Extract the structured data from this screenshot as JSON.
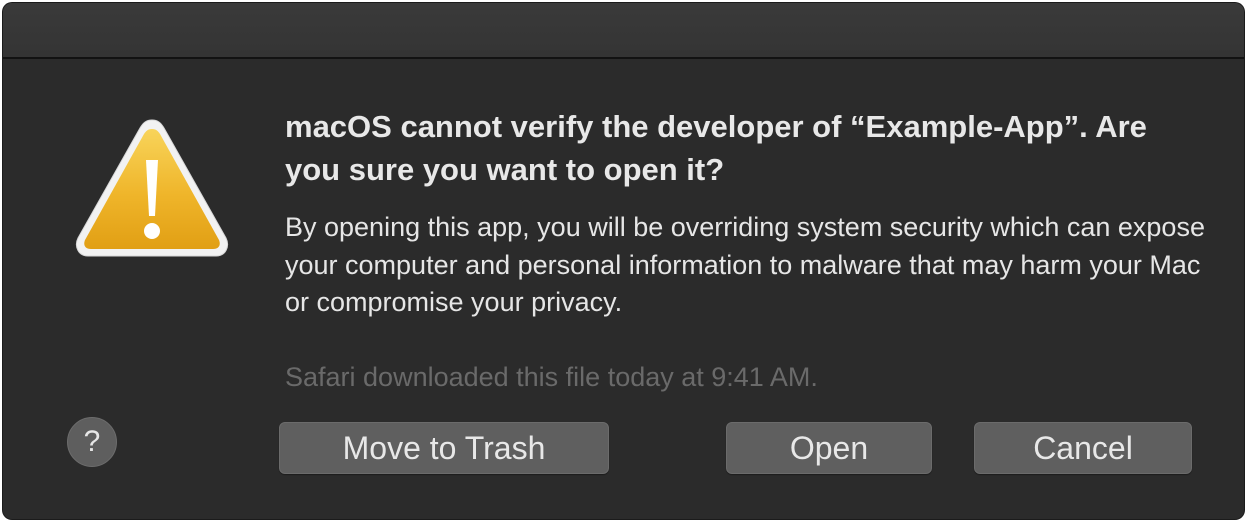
{
  "dialog": {
    "title": "macOS cannot verify the developer of “Example-App”. Are you sure you want to open it?",
    "body": "By opening this app, you will be overriding system security which can expose your computer and personal information to malware that may harm your Mac or compromise your privacy.",
    "meta": "Safari downloaded this file today at 9:41 AM.",
    "icon": "warning-triangle-icon",
    "help_label": "?",
    "buttons": {
      "move_to_trash": "Move to Trash",
      "open": "Open",
      "cancel": "Cancel"
    }
  },
  "colors": {
    "background": "#2b2b2b",
    "titlebar": "#373737",
    "button": "#5f5f5f",
    "text": "#e8e8e8",
    "muted_text": "#6a6a6a",
    "warning_yellow": "#f2b11f"
  }
}
